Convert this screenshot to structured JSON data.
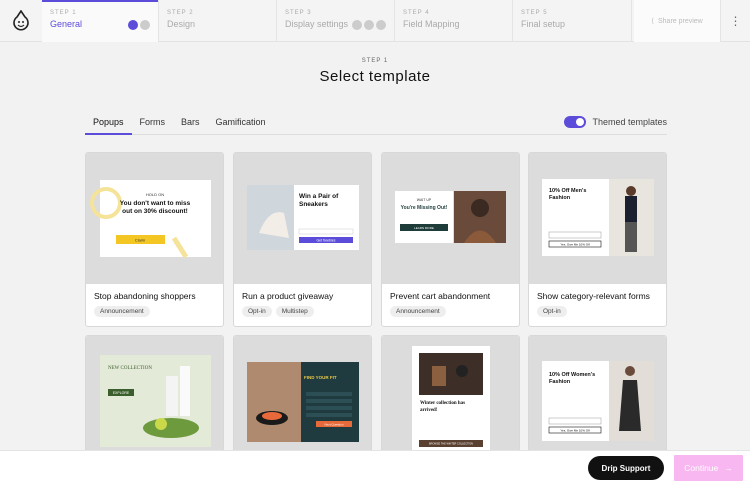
{
  "steps": [
    {
      "num": "STEP 1",
      "name": "General"
    },
    {
      "num": "STEP 2",
      "name": "Design"
    },
    {
      "num": "STEP 3",
      "name": "Display settings"
    },
    {
      "num": "STEP 4",
      "name": "Field Mapping"
    },
    {
      "num": "STEP 5",
      "name": "Final setup"
    }
  ],
  "share_label": "Share preview",
  "header": {
    "step": "STEP 1",
    "title": "Select template"
  },
  "tabs": [
    "Popups",
    "Forms",
    "Bars",
    "Gamification"
  ],
  "themed_label": "Themed templates",
  "cards": [
    {
      "name": "Stop abandoning shoppers",
      "tags": [
        "Announcement"
      ]
    },
    {
      "name": "Run a product giveaway",
      "tags": [
        "Opt-in",
        "Multistep"
      ]
    },
    {
      "name": "Prevent cart abandonment",
      "tags": [
        "Announcement"
      ]
    },
    {
      "name": "Show category-relevant forms",
      "tags": [
        "Opt-in"
      ]
    }
  ],
  "thumbs": {
    "t1": {
      "kicker": "HOLD ON",
      "headline": "You don't want to miss out on 30% discount!",
      "button": "Claim"
    },
    "t2": {
      "headline": "Win a Pair of Sneakers",
      "button": "Get freebies"
    },
    "t3": {
      "kicker": "WAIT UP",
      "headline": "You're Missing Out!",
      "button": "LEARN MORE"
    },
    "t4": {
      "headline": "10% Off Men's Fashion",
      "button": "Yes, Give Me 10% Off"
    },
    "t5": {
      "headline": "NEW COLLECTION",
      "button": "EXPLORE"
    },
    "t6": {
      "headline": "FIND YOUR FIT",
      "button": "Next Question"
    },
    "t7": {
      "headline": "Winter collection has arrived!",
      "button": "BROWSE THE WINTER COLLECTION"
    },
    "t8": {
      "headline": "10% Off Women's Fashion",
      "button": "Yes, Give Me 10% Off"
    }
  },
  "support_label": "Drip Support",
  "continue_label": "Continue",
  "colors": {
    "accent": "#5b4cd9",
    "continue_bg": "#f8b7f0",
    "support_bg": "#111111"
  }
}
